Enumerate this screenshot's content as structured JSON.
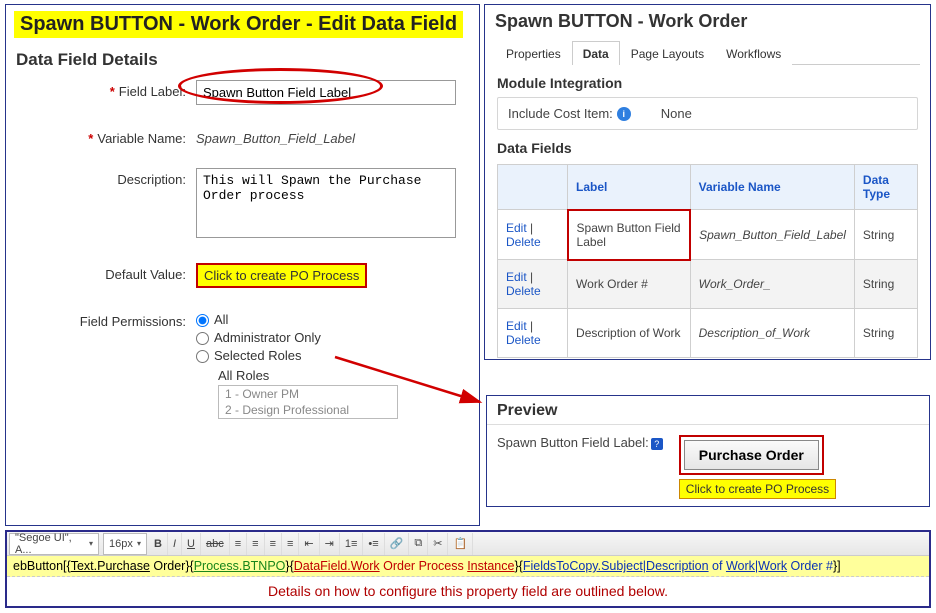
{
  "left": {
    "title": "Spawn BUTTON - Work Order - Edit Data Field",
    "section": "Data Field Details",
    "field_label_lbl": "Field Label:",
    "field_label_val": "Spawn Button Field Label",
    "variable_name_lbl": "Variable Name:",
    "variable_name_val": "Spawn_Button_Field_Label",
    "description_lbl": "Description:",
    "description_val": "This will Spawn the Purchase Order process",
    "default_value_lbl": "Default Value:",
    "default_value_val": "Click to create PO Process",
    "field_permissions_lbl": "Field Permissions:",
    "perm_all": "All",
    "perm_admin": "Administrator Only",
    "perm_selected": "Selected Roles",
    "all_roles_head": "All Roles",
    "roles": [
      "1 - Owner PM",
      "2 - Design Professional"
    ]
  },
  "right": {
    "title": "Spawn BUTTON - Work Order",
    "tabs": [
      "Properties",
      "Data",
      "Page Layouts",
      "Workflows"
    ],
    "active_tab": 1,
    "mi_head": "Module Integration",
    "mi_label": "Include Cost Item:",
    "mi_value": "None",
    "df_head": "Data Fields",
    "df_cols": [
      "",
      "Label",
      "Variable Name",
      "Data Type"
    ],
    "edit": "Edit",
    "delete": "Delete",
    "rows": [
      {
        "label": "Spawn Button Field Label",
        "vn": "Spawn_Button_Field_Label",
        "dt": "String",
        "hl": true
      },
      {
        "label": "Work Order #",
        "vn": "Work_Order_",
        "dt": "String",
        "hl": false
      },
      {
        "label": "Description of Work",
        "vn": "Description_of_Work",
        "dt": "String",
        "hl": false
      }
    ]
  },
  "preview": {
    "title": "Preview",
    "label": "Spawn Button Field Label:",
    "button": "Purchase Order",
    "hint": "Click to create PO Process"
  },
  "editor": {
    "font": "\"Segoe UI\", A...",
    "size": "16px",
    "formula_parts": [
      {
        "cls": "t-blk",
        "txt": "ebButton[{"
      },
      {
        "cls": "t-blk ul",
        "txt": "Text.Purchase"
      },
      {
        "cls": "t-blk",
        "txt": " Order}{"
      },
      {
        "cls": "t-grn ul",
        "txt": "Process.BTNPO"
      },
      {
        "cls": "t-blk",
        "txt": "}{"
      },
      {
        "cls": "t-red ul",
        "txt": "DataField.Work"
      },
      {
        "cls": "t-red",
        "txt": " Order Process "
      },
      {
        "cls": "t-red ul",
        "txt": "Instance"
      },
      {
        "cls": "t-blk",
        "txt": "}{"
      },
      {
        "cls": "t-blu ul",
        "txt": "FieldsToCopy.Subject|Description"
      },
      {
        "cls": "t-blu",
        "txt": " of "
      },
      {
        "cls": "t-blu ul",
        "txt": "Work|Work"
      },
      {
        "cls": "t-blu",
        "txt": " Order #"
      },
      {
        "cls": "t-blk",
        "txt": "}]"
      }
    ],
    "caption": "Details on how to configure this property field are outlined below."
  }
}
